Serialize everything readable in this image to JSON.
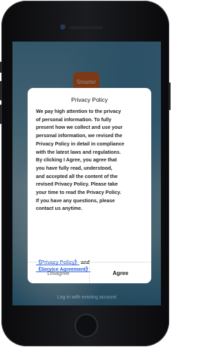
{
  "app": {
    "logo_text": "Smarter",
    "footer_link": "Log in with existing account"
  },
  "dialog": {
    "title": "Privacy Policy",
    "body": "We pay high attention to the privacy\nof personal information. To fully\npresent how we collect and use your\npersonal information, we revised the\nPrivacy Policy in detail in compliance\nwith the latest laws and regulations.\nBy clicking I Agree, you agree that\nyou have fully read, understood,\nand accepted all the content of the\nrevised Privacy Policy. Please take\nyour time to read the Privacy Policy.\nIf you have any questions, please\ncontact us anytime.",
    "privacy_link": "《Privacy Policy》",
    "and_text": " and ",
    "service_link": "《Service Agreement》",
    "disagree_label": "Disagree",
    "agree_label": "Agree"
  },
  "colors": {
    "accent_link": "#2b5fd9",
    "logo_bg": "#e3662b"
  }
}
